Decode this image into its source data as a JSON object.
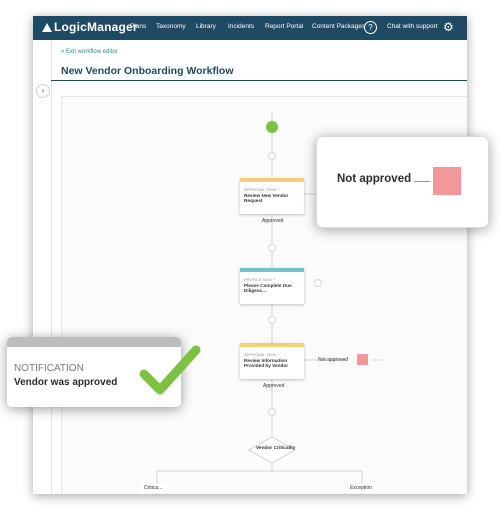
{
  "header": {
    "logo": "LogicManager",
    "nav": [
      "Plans",
      "Taxonomy",
      "Library",
      "Incidents",
      "Report Portal",
      "Content Packages"
    ],
    "help_glyph": "?",
    "support": "Chat with support",
    "settings_icon": "gear-icon"
  },
  "page": {
    "exit_link": "Exit workflow editor",
    "title": "New Vendor Onboarding Workflow",
    "sidebar_toggle_glyph": "›"
  },
  "workflow": {
    "tasks": [
      {
        "type": "APPROVAL TASK *",
        "name": "Review New Vendor Request"
      },
      {
        "type": "PROFILE TASK *",
        "name": "Please Complete Due Diligenc..."
      },
      {
        "type": "APPROVAL TASK *",
        "name": "Review Information Provided by Vendor"
      }
    ],
    "approved_1": "Approved",
    "approved_2": "Approved",
    "not_approved": "Not approved",
    "decision": "Vendor Criticality",
    "branch_left": "Critica...",
    "branch_right": "Exception"
  },
  "callouts": {
    "not_approved": "Not approved",
    "notification_head": "NOTIFICATION",
    "notification_text": "Vendor was approved"
  },
  "colors": {
    "header": "#1f4a63",
    "start_node": "#7cc141",
    "approval_band": "#f3cf7a",
    "profile_band": "#74c2cf",
    "reject_marker": "#f0989a",
    "check": "#7cc141",
    "link": "#2f8b7e"
  }
}
